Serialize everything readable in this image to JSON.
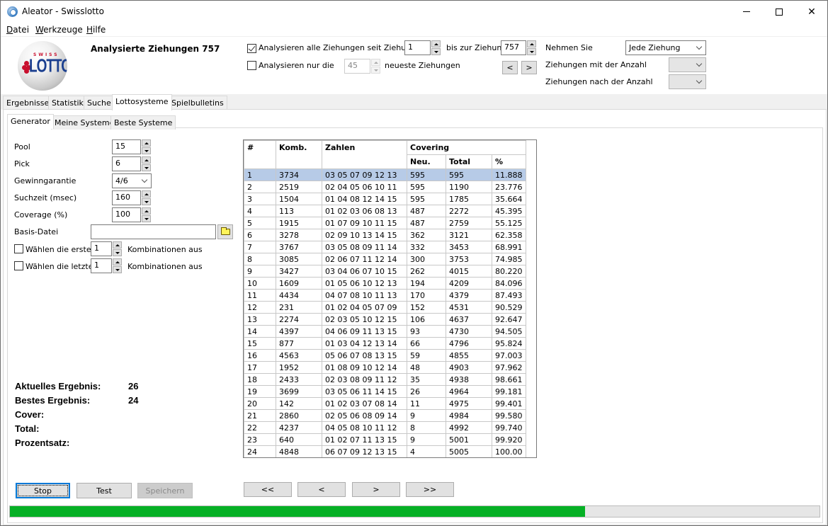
{
  "window": {
    "title": "Aleator - Swisslotto",
    "controls": {
      "minimize": "minimize",
      "maximize": "maximize",
      "close": "close"
    }
  },
  "menu": [
    {
      "accel": "D",
      "rest": "atei"
    },
    {
      "accel": "W",
      "rest": "erkzeuge"
    },
    {
      "accel": "H",
      "rest": "ilfe"
    }
  ],
  "header": {
    "logo": {
      "top": "SWISS",
      "main": "LOTTO"
    },
    "analysed_label": "Analysierte Ziehungen 757",
    "all_draws": {
      "checked": true,
      "label": "Analysieren alle Ziehungen seit Ziehung",
      "from_value": "1",
      "to_label": "bis zur Ziehung",
      "to_value": "757"
    },
    "only_latest": {
      "checked": false,
      "label": "Analysieren nur die",
      "value": "45",
      "suffix": "neueste Ziehungen"
    },
    "nav": {
      "prev": "<",
      "next": ">"
    },
    "take": {
      "label": "Nehmen Sie",
      "value": "Jede Ziehung"
    },
    "with_count": {
      "label": "Ziehungen mit der Anzahl",
      "value": ""
    },
    "after_count": {
      "label": "Ziehungen nach der Anzahl",
      "value": ""
    }
  },
  "tabs": [
    "Ergebnisse",
    "Statistik",
    "Suche",
    "Lottosysteme",
    "Spielbulletins"
  ],
  "active_tab": "Lottosysteme",
  "subtabs": [
    "Generator",
    "Meine Systeme",
    "Beste Systeme"
  ],
  "active_subtab": "Generator",
  "generator": {
    "pool": {
      "label": "Pool",
      "value": "15"
    },
    "pick": {
      "label": "Pick",
      "value": "6"
    },
    "guarantee": {
      "label": "Gewinngarantie",
      "value": "4/6"
    },
    "search_time": {
      "label": "Suchzeit (msec)",
      "value": "160"
    },
    "coverage": {
      "label": "Coverage (%)",
      "value": "100"
    },
    "base_file": {
      "label": "Basis-Datei",
      "value": ""
    },
    "first": {
      "checked": false,
      "label": "Wählen die ersten",
      "value": "1",
      "suffix": "Kombinationen aus"
    },
    "last": {
      "checked": false,
      "label": "Wählen die letzten",
      "value": "1",
      "suffix": "Kombinationen aus"
    }
  },
  "results": {
    "current": {
      "label": "Aktuelles Ergebnis:",
      "value": "26"
    },
    "best": {
      "label": "Bestes Ergebnis:",
      "value": "24"
    },
    "cover": {
      "label": "Cover:",
      "value": ""
    },
    "total": {
      "label": "Total:",
      "value": ""
    },
    "percent": {
      "label": "Prozentsatz:",
      "value": ""
    }
  },
  "table": {
    "headers": {
      "num": "#",
      "komb": "Komb.",
      "zahlen": "Zahlen",
      "covering": "Covering",
      "neu": "Neu.",
      "total": "Total",
      "pct": "%"
    },
    "selected_row": 0,
    "rows": [
      [
        "1",
        "3734",
        "03 05 07 09 12 13",
        "595",
        "595",
        "11.888"
      ],
      [
        "2",
        "2519",
        "02 04 05 06 10 11",
        "595",
        "1190",
        "23.776"
      ],
      [
        "3",
        "1504",
        "01 04 08 12 14 15",
        "595",
        "1785",
        "35.664"
      ],
      [
        "4",
        "113",
        "01 02 03 06 08 13",
        "487",
        "2272",
        "45.395"
      ],
      [
        "5",
        "1915",
        "01 07 09 10 11 15",
        "487",
        "2759",
        "55.125"
      ],
      [
        "6",
        "3278",
        "02 09 10 13 14 15",
        "362",
        "3121",
        "62.358"
      ],
      [
        "7",
        "3767",
        "03 05 08 09 11 14",
        "332",
        "3453",
        "68.991"
      ],
      [
        "8",
        "3085",
        "02 06 07 11 12 14",
        "300",
        "3753",
        "74.985"
      ],
      [
        "9",
        "3427",
        "03 04 06 07 10 15",
        "262",
        "4015",
        "80.220"
      ],
      [
        "10",
        "1609",
        "01 05 06 10 12 13",
        "194",
        "4209",
        "84.096"
      ],
      [
        "11",
        "4434",
        "04 07 08 10 11 13",
        "170",
        "4379",
        "87.493"
      ],
      [
        "12",
        "231",
        "01 02 04 05 07 09",
        "152",
        "4531",
        "90.529"
      ],
      [
        "13",
        "2274",
        "02 03 05 10 12 15",
        "106",
        "4637",
        "92.647"
      ],
      [
        "14",
        "4397",
        "04 06 09 11 13 15",
        "93",
        "4730",
        "94.505"
      ],
      [
        "15",
        "877",
        "01 03 04 12 13 14",
        "66",
        "4796",
        "95.824"
      ],
      [
        "16",
        "4563",
        "05 06 07 08 13 15",
        "59",
        "4855",
        "97.003"
      ],
      [
        "17",
        "1952",
        "01 08 09 10 12 14",
        "48",
        "4903",
        "97.962"
      ],
      [
        "18",
        "2433",
        "02 03 08 09 11 12",
        "35",
        "4938",
        "98.661"
      ],
      [
        "19",
        "3699",
        "03 05 06 11 14 15",
        "26",
        "4964",
        "99.181"
      ],
      [
        "20",
        "142",
        "01 02 03 07 08 14",
        "11",
        "4975",
        "99.401"
      ],
      [
        "21",
        "2860",
        "02 05 06 08 09 14",
        "9",
        "4984",
        "99.580"
      ],
      [
        "22",
        "4237",
        "04 05 08 10 11 12",
        "8",
        "4992",
        "99.740"
      ],
      [
        "23",
        "640",
        "01 02 07 11 13 15",
        "9",
        "5001",
        "99.920"
      ],
      [
        "24",
        "4848",
        "06 07 09 12 13 15",
        "4",
        "5005",
        "100.00"
      ]
    ]
  },
  "buttons": {
    "stop": "Stop",
    "test": "Test",
    "save": "Speichern",
    "first": "<<",
    "prev": "<",
    "next": ">",
    "last": ">>"
  },
  "progress": {
    "percent": 71,
    "color": "#06b025"
  },
  "colors": {
    "selection": "#b7cbe7",
    "accent": "#0078d7"
  }
}
